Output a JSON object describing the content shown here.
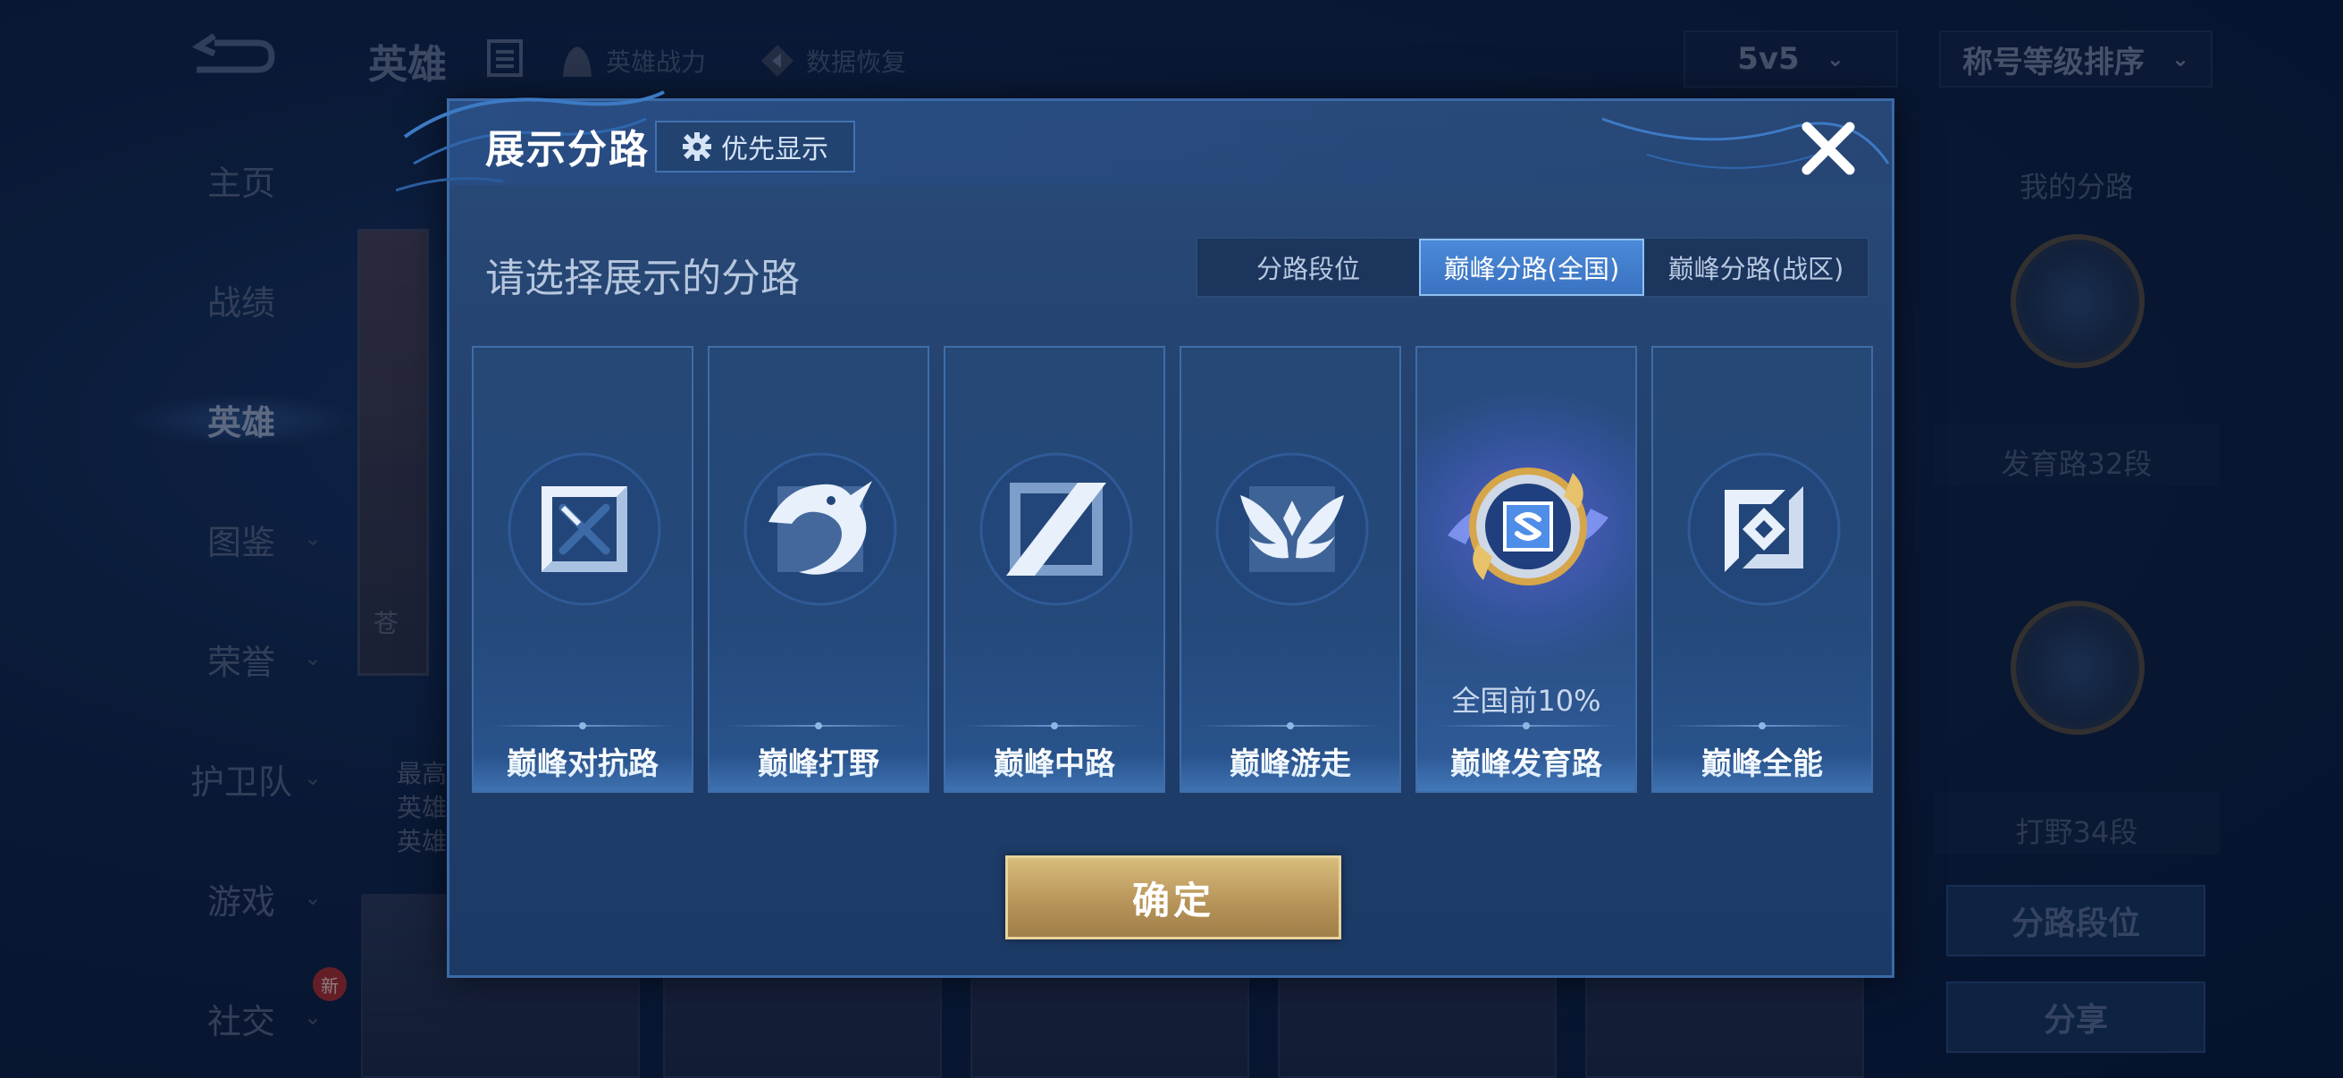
{
  "background": {
    "page_title": "英雄",
    "tools": [
      "英雄战力",
      "数据恢复"
    ],
    "mode_select": "5v5",
    "sort_select": "称号等级排序",
    "nav_items": [
      {
        "label": "主页"
      },
      {
        "label": "战绩"
      },
      {
        "label": "英雄"
      },
      {
        "label": "图鉴"
      },
      {
        "label": "荣誉"
      },
      {
        "label": "护卫队"
      },
      {
        "label": "游戏"
      },
      {
        "label": "社交"
      }
    ],
    "new_badge": "新",
    "hero_card_name": "苍",
    "hero_card_lines": [
      "最高",
      "英雄",
      "英雄"
    ],
    "right_panel": {
      "title": "我的分路",
      "lane1": "发育路32段",
      "lane2": "打野34段",
      "button_rank": "分路段位",
      "button_share": "分享"
    }
  },
  "modal": {
    "title": "展示分路",
    "priority_button": "优先显示",
    "prompt": "请选择展示的分路",
    "tabs": [
      {
        "label": "分路段位",
        "selected": false
      },
      {
        "label": "巅峰分路(全国)",
        "selected": true
      },
      {
        "label": "巅峰分路(战区)",
        "selected": false
      }
    ],
    "lanes": [
      {
        "label": "巅峰对抗路",
        "icon": "clash-lane-icon",
        "rank": ""
      },
      {
        "label": "巅峰打野",
        "icon": "jungle-dragon-icon",
        "rank": ""
      },
      {
        "label": "巅峰中路",
        "icon": "mid-lane-icon",
        "rank": ""
      },
      {
        "label": "巅峰游走",
        "icon": "roam-wings-icon",
        "rank": ""
      },
      {
        "label": "巅峰发育路",
        "icon": "farm-lane-badge-icon",
        "rank": "全国前10%",
        "highlighted": true
      },
      {
        "label": "巅峰全能",
        "icon": "all-round-icon",
        "rank": ""
      }
    ],
    "confirm_button": "确定"
  },
  "colors": {
    "accent_blue": "#4a8ad8",
    "confirm_gold": "#c9a86a",
    "modal_bg": "#234270"
  }
}
